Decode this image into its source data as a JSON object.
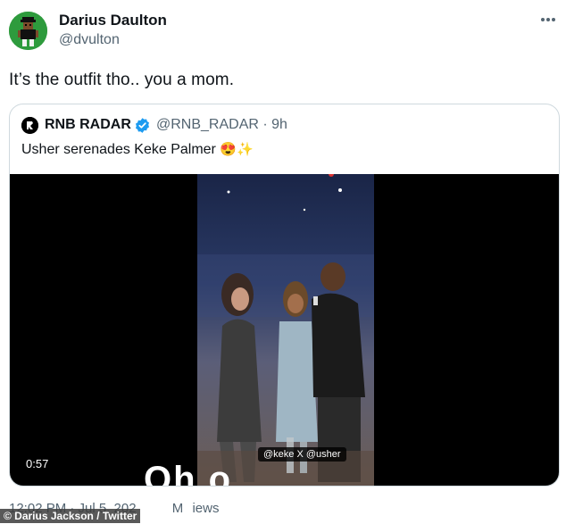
{
  "author": {
    "display_name": "Darius Daulton",
    "handle": "@dvulton",
    "avatar_icon": "pixel-character-avatar",
    "avatar_bg": "#2e9b3d"
  },
  "tweet": {
    "text": "It’s the outfit tho.. you a mom.",
    "timestamp": "12:02 PM · Jul 5, 202",
    "views_fragment": "M",
    "views_label": "iews"
  },
  "quote": {
    "name": "RNB RADAR",
    "verified_icon": "verified-badge-icon",
    "verified_color": "#1d9bf0",
    "meta": "@RNB_RADAR · 9h",
    "text": "Usher serenades Keke Palmer",
    "emoji": "😍✨",
    "video": {
      "duration": "0:57",
      "caption": "@keke X @usher",
      "subtitle": "Oh  o"
    }
  },
  "credit": "© Darius Jackson / Twitter"
}
